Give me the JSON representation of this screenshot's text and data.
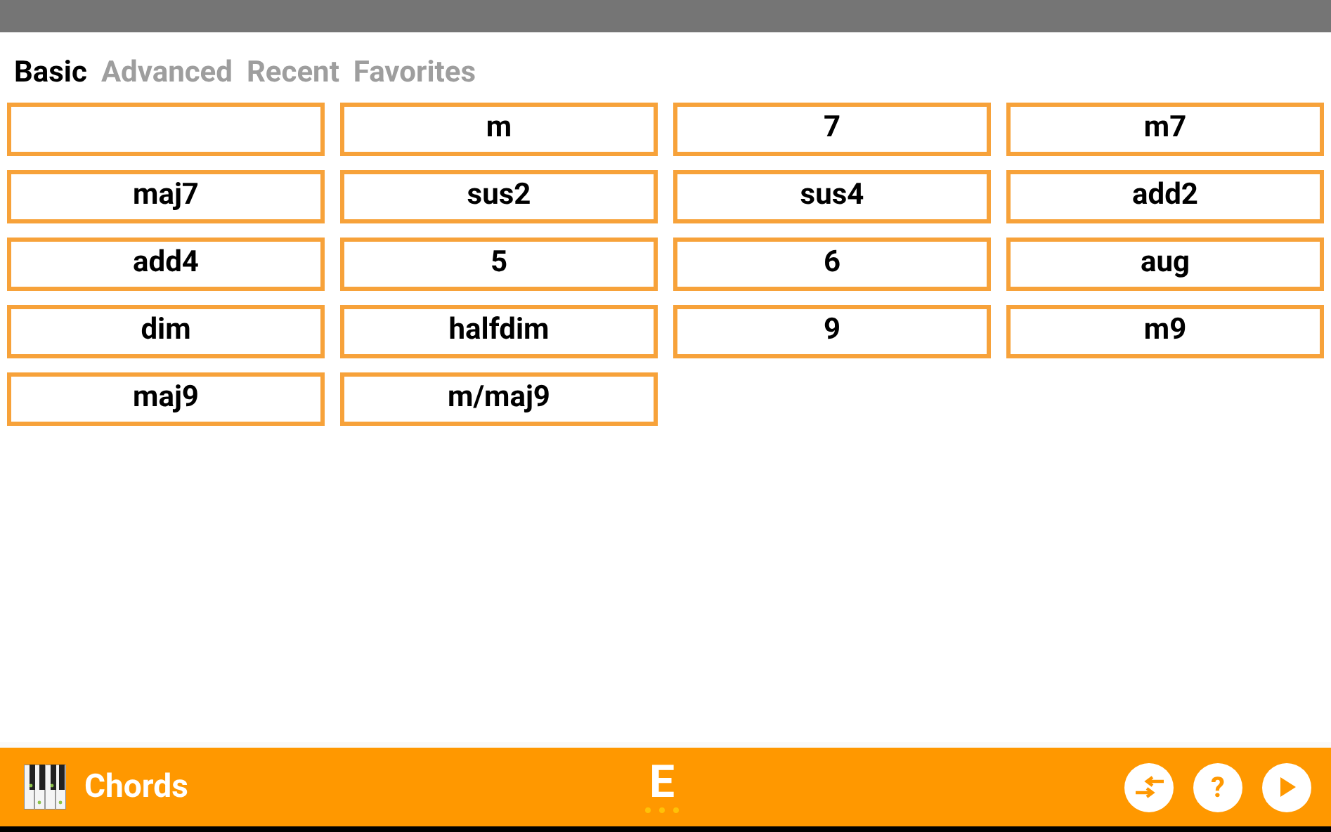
{
  "tabs": [
    {
      "label": "Basic",
      "selected": true
    },
    {
      "label": "Advanced",
      "selected": false
    },
    {
      "label": "Recent",
      "selected": false
    },
    {
      "label": "Favorites",
      "selected": false
    }
  ],
  "chords": [
    {
      "kind": "blank"
    },
    {
      "kind": "chord",
      "label": "m"
    },
    {
      "kind": "chord",
      "label": "7"
    },
    {
      "kind": "chord",
      "label": "m7"
    },
    {
      "kind": "chord",
      "label": "maj7"
    },
    {
      "kind": "chord",
      "label": "sus2"
    },
    {
      "kind": "chord",
      "label": "sus4"
    },
    {
      "kind": "chord",
      "label": "add2"
    },
    {
      "kind": "chord",
      "label": "add4"
    },
    {
      "kind": "chord",
      "label": "5"
    },
    {
      "kind": "chord",
      "label": "6"
    },
    {
      "kind": "chord",
      "label": "aug"
    },
    {
      "kind": "chord",
      "label": "dim"
    },
    {
      "kind": "chord",
      "label": "halfdim"
    },
    {
      "kind": "chord",
      "label": "9"
    },
    {
      "kind": "chord",
      "label": "m9"
    },
    {
      "kind": "chord",
      "label": "maj9"
    },
    {
      "kind": "chord",
      "label": "m/maj9"
    }
  ],
  "bottom_bar": {
    "title": "Chords",
    "key": "E",
    "help": "?"
  }
}
